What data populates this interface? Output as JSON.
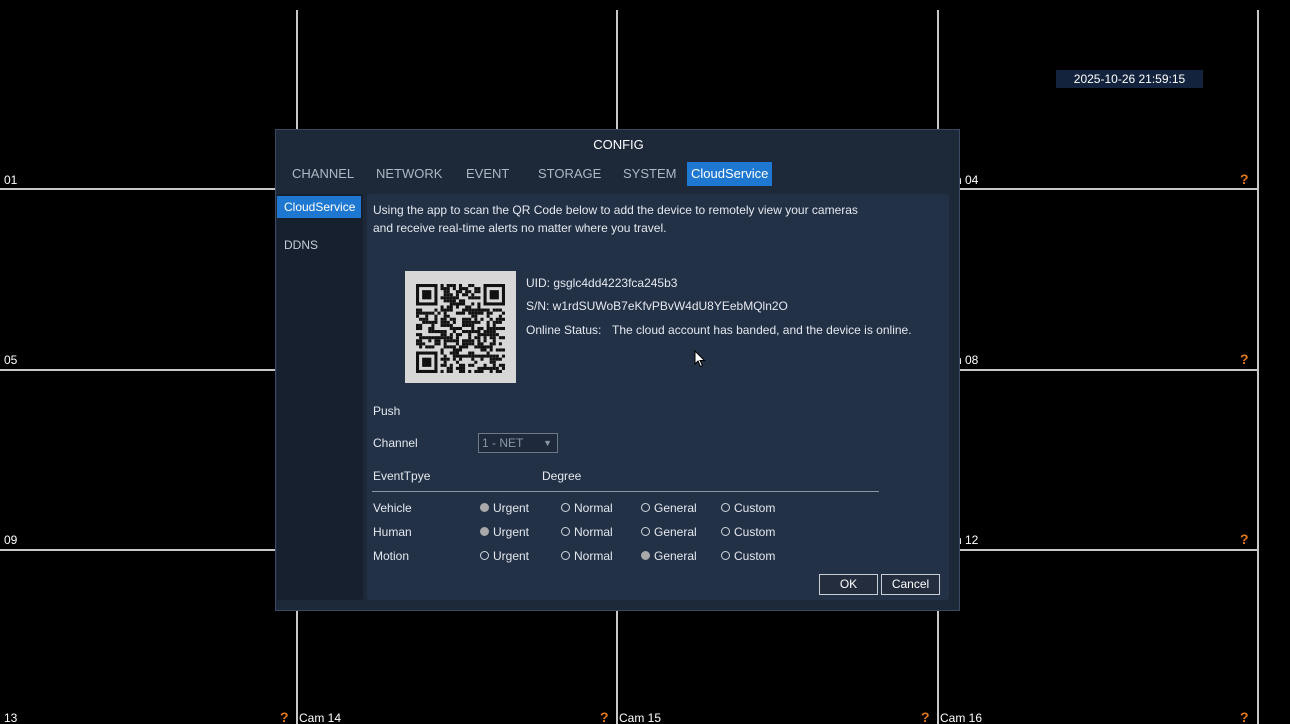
{
  "datetime": "2025-10-26 21:59:15",
  "cameras": {
    "c01": "01",
    "c04": "n 04",
    "c05": "05",
    "c08": "n 08",
    "c09": "09",
    "c12": "n 12",
    "c13": "13",
    "c14": "Cam 14",
    "c15": "Cam 15",
    "c16": "Cam 16",
    "no_signal": "?"
  },
  "dialog": {
    "title": "CONFIG",
    "tabs": [
      "CHANNEL",
      "NETWORK",
      "EVENT",
      "STORAGE",
      "SYSTEM",
      "CloudService"
    ],
    "active_tab": "CloudService",
    "side_items": [
      "CloudService",
      "DDNS"
    ],
    "intro_line1": "Using the app to scan the QR Code below to add the device to remotely view your cameras",
    "intro_line2": "and receive real-time alerts no matter where you travel.",
    "uid": "UID: gsglc4dd4223fca245b3",
    "sn": "S/N: w1rdSUWoB7eKfvPBvW4dU8YEebMQln2O",
    "online_status_label": "Online Status:",
    "online_status_value": "The cloud account has banded, and the device is online.",
    "push_label": "Push",
    "channel_label": "Channel",
    "channel_value": "1 - NET",
    "event_type_header": "EventTpye",
    "degree_header": "Degree",
    "options": [
      "Urgent",
      "Normal",
      "General",
      "Custom"
    ],
    "rows": [
      {
        "name": "Vehicle",
        "selected": "Urgent"
      },
      {
        "name": "Human",
        "selected": "Urgent"
      },
      {
        "name": "Motion",
        "selected": "General"
      }
    ],
    "ok_label": "OK",
    "cancel_label": "Cancel"
  },
  "colors": {
    "accent": "#1e78d2",
    "dialog_bg": "#1d2839",
    "panel_bg": "#233147",
    "warning": "#e0781e"
  },
  "icons": {
    "no_signal": "question-icon",
    "pointer": "mouse-cursor-icon",
    "qr": "qr-code-icon"
  }
}
